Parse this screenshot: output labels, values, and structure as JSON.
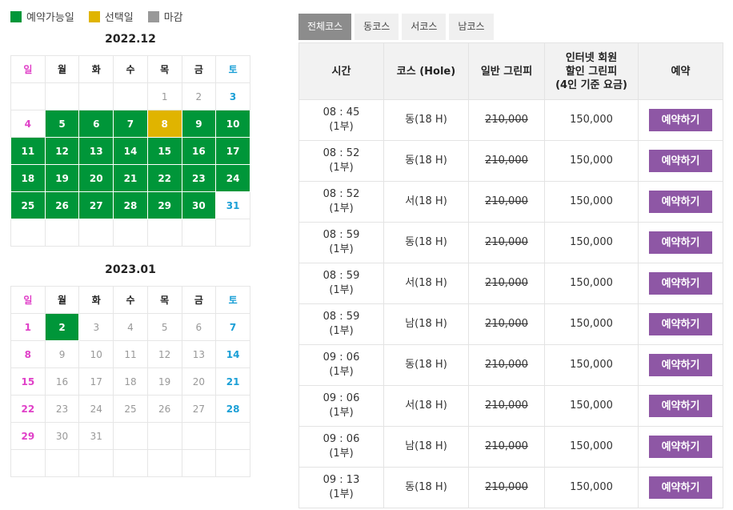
{
  "legend": [
    {
      "label": "예약가능일",
      "color": "#009639"
    },
    {
      "label": "선택일",
      "color": "#e0b400"
    },
    {
      "label": "마감",
      "color": "#999999"
    }
  ],
  "weekdays": [
    "일",
    "월",
    "화",
    "수",
    "목",
    "금",
    "토"
  ],
  "calendars": [
    {
      "title": "2022.12",
      "weeks": [
        [
          {
            "d": "",
            "s": ""
          },
          {
            "d": "",
            "s": ""
          },
          {
            "d": "",
            "s": ""
          },
          {
            "d": "",
            "s": ""
          },
          {
            "d": "1",
            "s": "closed"
          },
          {
            "d": "2",
            "s": "closed"
          },
          {
            "d": "3",
            "s": "sat"
          }
        ],
        [
          {
            "d": "4",
            "s": "sun"
          },
          {
            "d": "5",
            "s": "avail"
          },
          {
            "d": "6",
            "s": "avail"
          },
          {
            "d": "7",
            "s": "avail"
          },
          {
            "d": "8",
            "s": "sel"
          },
          {
            "d": "9",
            "s": "avail"
          },
          {
            "d": "10",
            "s": "avail"
          }
        ],
        [
          {
            "d": "11",
            "s": "avail"
          },
          {
            "d": "12",
            "s": "avail"
          },
          {
            "d": "13",
            "s": "avail"
          },
          {
            "d": "14",
            "s": "avail"
          },
          {
            "d": "15",
            "s": "avail"
          },
          {
            "d": "16",
            "s": "avail"
          },
          {
            "d": "17",
            "s": "avail"
          }
        ],
        [
          {
            "d": "18",
            "s": "avail"
          },
          {
            "d": "19",
            "s": "avail"
          },
          {
            "d": "20",
            "s": "avail"
          },
          {
            "d": "21",
            "s": "avail"
          },
          {
            "d": "22",
            "s": "avail"
          },
          {
            "d": "23",
            "s": "avail"
          },
          {
            "d": "24",
            "s": "avail"
          }
        ],
        [
          {
            "d": "25",
            "s": "avail"
          },
          {
            "d": "26",
            "s": "avail"
          },
          {
            "d": "27",
            "s": "avail"
          },
          {
            "d": "28",
            "s": "avail"
          },
          {
            "d": "29",
            "s": "avail"
          },
          {
            "d": "30",
            "s": "avail"
          },
          {
            "d": "31",
            "s": "sat"
          }
        ],
        [
          {
            "d": "",
            "s": ""
          },
          {
            "d": "",
            "s": ""
          },
          {
            "d": "",
            "s": ""
          },
          {
            "d": "",
            "s": ""
          },
          {
            "d": "",
            "s": ""
          },
          {
            "d": "",
            "s": ""
          },
          {
            "d": "",
            "s": ""
          }
        ]
      ]
    },
    {
      "title": "2023.01",
      "weeks": [
        [
          {
            "d": "1",
            "s": "sun"
          },
          {
            "d": "2",
            "s": "avail"
          },
          {
            "d": "3",
            "s": "closed"
          },
          {
            "d": "4",
            "s": "closed"
          },
          {
            "d": "5",
            "s": "closed"
          },
          {
            "d": "6",
            "s": "closed"
          },
          {
            "d": "7",
            "s": "sat"
          }
        ],
        [
          {
            "d": "8",
            "s": "sun"
          },
          {
            "d": "9",
            "s": "closed"
          },
          {
            "d": "10",
            "s": "closed"
          },
          {
            "d": "11",
            "s": "closed"
          },
          {
            "d": "12",
            "s": "closed"
          },
          {
            "d": "13",
            "s": "closed"
          },
          {
            "d": "14",
            "s": "sat"
          }
        ],
        [
          {
            "d": "15",
            "s": "sun"
          },
          {
            "d": "16",
            "s": "closed"
          },
          {
            "d": "17",
            "s": "closed"
          },
          {
            "d": "18",
            "s": "closed"
          },
          {
            "d": "19",
            "s": "closed"
          },
          {
            "d": "20",
            "s": "closed"
          },
          {
            "d": "21",
            "s": "sat"
          }
        ],
        [
          {
            "d": "22",
            "s": "sun"
          },
          {
            "d": "23",
            "s": "closed"
          },
          {
            "d": "24",
            "s": "closed"
          },
          {
            "d": "25",
            "s": "closed"
          },
          {
            "d": "26",
            "s": "closed"
          },
          {
            "d": "27",
            "s": "closed"
          },
          {
            "d": "28",
            "s": "sat"
          }
        ],
        [
          {
            "d": "29",
            "s": "sun"
          },
          {
            "d": "30",
            "s": "closed"
          },
          {
            "d": "31",
            "s": "closed"
          },
          {
            "d": "",
            "s": ""
          },
          {
            "d": "",
            "s": ""
          },
          {
            "d": "",
            "s": ""
          },
          {
            "d": "",
            "s": ""
          }
        ],
        [
          {
            "d": "",
            "s": ""
          },
          {
            "d": "",
            "s": ""
          },
          {
            "d": "",
            "s": ""
          },
          {
            "d": "",
            "s": ""
          },
          {
            "d": "",
            "s": ""
          },
          {
            "d": "",
            "s": ""
          },
          {
            "d": "",
            "s": ""
          }
        ]
      ]
    }
  ],
  "tabs": [
    {
      "label": "전체코스",
      "active": true
    },
    {
      "label": "동코스",
      "active": false
    },
    {
      "label": "서코스",
      "active": false
    },
    {
      "label": "남코스",
      "active": false
    }
  ],
  "table": {
    "headers": [
      "시간",
      "코스 (Hole)",
      "일반 그린피",
      "인터넷 회원\n할인 그린피\n(4인 기준 요금)",
      "예약"
    ],
    "button_label": "예약하기",
    "rows": [
      {
        "time": "08 : 45",
        "part": "(1부)",
        "course": "동(18 H)",
        "regular": "210,000",
        "discount": "150,000"
      },
      {
        "time": "08 : 52",
        "part": "(1부)",
        "course": "동(18 H)",
        "regular": "210,000",
        "discount": "150,000"
      },
      {
        "time": "08 : 52",
        "part": "(1부)",
        "course": "서(18 H)",
        "regular": "210,000",
        "discount": "150,000"
      },
      {
        "time": "08 : 59",
        "part": "(1부)",
        "course": "동(18 H)",
        "regular": "210,000",
        "discount": "150,000"
      },
      {
        "time": "08 : 59",
        "part": "(1부)",
        "course": "서(18 H)",
        "regular": "210,000",
        "discount": "150,000"
      },
      {
        "time": "08 : 59",
        "part": "(1부)",
        "course": "남(18 H)",
        "regular": "210,000",
        "discount": "150,000"
      },
      {
        "time": "09 : 06",
        "part": "(1부)",
        "course": "동(18 H)",
        "regular": "210,000",
        "discount": "150,000"
      },
      {
        "time": "09 : 06",
        "part": "(1부)",
        "course": "서(18 H)",
        "regular": "210,000",
        "discount": "150,000"
      },
      {
        "time": "09 : 06",
        "part": "(1부)",
        "course": "남(18 H)",
        "regular": "210,000",
        "discount": "150,000"
      },
      {
        "time": "09 : 13",
        "part": "(1부)",
        "course": "동(18 H)",
        "regular": "210,000",
        "discount": "150,000"
      }
    ]
  }
}
